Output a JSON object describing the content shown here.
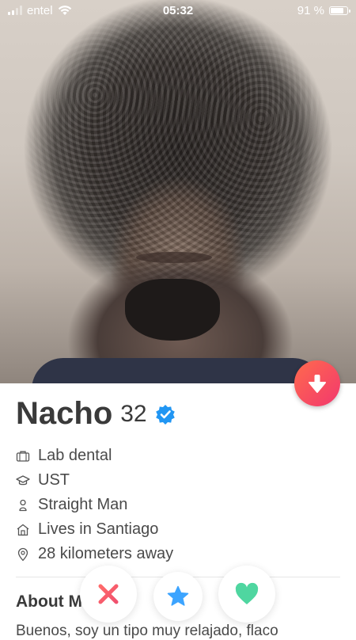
{
  "status_bar": {
    "carrier": "entel",
    "time": "05:32",
    "battery_percent": "91 %",
    "battery_level": 0.91,
    "signal_bars": 2
  },
  "profile": {
    "name": "Nacho",
    "age": "32",
    "verified": true,
    "details": [
      {
        "icon": "briefcase-icon",
        "text": "Lab dental"
      },
      {
        "icon": "graduation-cap-icon",
        "text": "UST"
      },
      {
        "icon": "person-icon",
        "text": "Straight Man"
      },
      {
        "icon": "home-icon",
        "text": "Lives in Santiago"
      },
      {
        "icon": "location-pin-icon",
        "text": "28 kilometers away"
      }
    ],
    "about_title": "About M",
    "bio": "Buenos, soy un tipo muy relajado, flaco"
  },
  "colors": {
    "accent_gradient_start": "#ff6a4d",
    "accent_gradient_end": "#f2386e",
    "nope": "#f0506e",
    "superlike": "#3ca4ff",
    "like": "#4fd6a0",
    "verified": "#2196f3"
  }
}
